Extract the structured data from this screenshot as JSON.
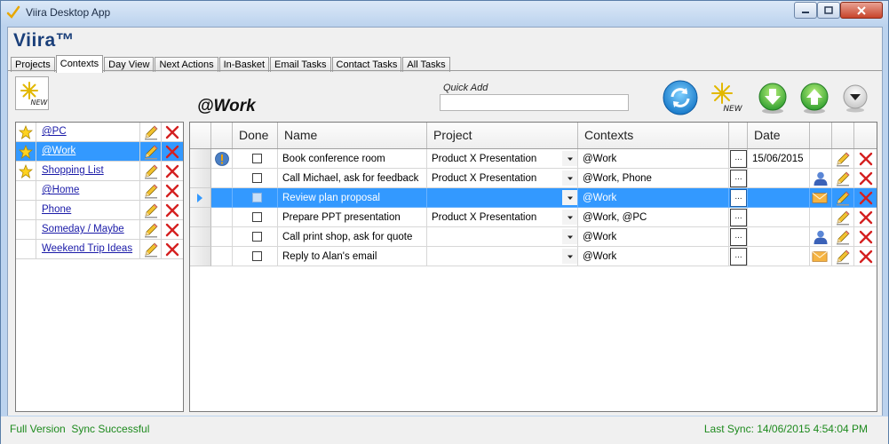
{
  "window": {
    "title": "Viira Desktop App"
  },
  "app": {
    "brand": "Viira™"
  },
  "tabs": [
    {
      "label": "Projects"
    },
    {
      "label": "Contexts",
      "active": true
    },
    {
      "label": "Day View"
    },
    {
      "label": "Next Actions"
    },
    {
      "label": "In-Basket"
    },
    {
      "label": "Email Tasks"
    },
    {
      "label": "Contact Tasks"
    },
    {
      "label": "All Tasks"
    }
  ],
  "toolbar": {
    "new_badge": "NEW",
    "quick_add_label": "Quick Add",
    "quick_add_value": "",
    "icons": [
      "sync-icon",
      "new-task-icon",
      "move-down-icon",
      "move-up-icon",
      "dropdown-menu-icon"
    ]
  },
  "context_heading": "@Work",
  "contexts": [
    {
      "label": "@PC",
      "starred": true,
      "selected": false
    },
    {
      "label": "@Work",
      "starred": true,
      "selected": true
    },
    {
      "label": "Shopping List",
      "starred": true,
      "selected": false
    },
    {
      "label": "@Home",
      "starred": false,
      "selected": false
    },
    {
      "label": "Phone",
      "starred": false,
      "selected": false
    },
    {
      "label": "Someday / Maybe",
      "starred": false,
      "selected": false
    },
    {
      "label": "Weekend Trip Ideas",
      "starred": false,
      "selected": false
    }
  ],
  "grid": {
    "columns": {
      "done": "Done",
      "name": "Name",
      "project": "Project",
      "contexts": "Contexts",
      "date": "Date"
    },
    "ellipsis_label": "...",
    "rows": [
      {
        "priority": true,
        "done": false,
        "name": "Book conference room",
        "project": "Product X Presentation",
        "contexts": "@Work",
        "date": "15/06/2015",
        "type": "",
        "selected": false
      },
      {
        "priority": false,
        "done": false,
        "name": "Call Michael, ask for feedback",
        "project": "Product X Presentation",
        "contexts": "@Work, Phone",
        "date": "",
        "type": "contact",
        "selected": false
      },
      {
        "priority": false,
        "done": false,
        "name": "Review plan proposal",
        "project": "",
        "contexts": "@Work",
        "date": "",
        "type": "email",
        "selected": true
      },
      {
        "priority": false,
        "done": false,
        "name": "Prepare PPT presentation",
        "project": "Product X Presentation",
        "contexts": "@Work, @PC",
        "date": "",
        "type": "",
        "selected": false
      },
      {
        "priority": false,
        "done": false,
        "name": "Call print shop, ask for quote",
        "project": "",
        "contexts": "@Work",
        "date": "",
        "type": "contact",
        "selected": false
      },
      {
        "priority": false,
        "done": false,
        "name": "Reply to Alan's email",
        "project": "",
        "contexts": "@Work",
        "date": "",
        "type": "email",
        "selected": false
      }
    ]
  },
  "status": {
    "left": "Full Version  Sync Successful",
    "right": "Last Sync: 14/06/2015 4:54:04 PM"
  },
  "colors": {
    "selection": "#3399ff",
    "status_text": "#1d8a1d",
    "delete": "#d42020",
    "brand": "#1a3f7a"
  }
}
